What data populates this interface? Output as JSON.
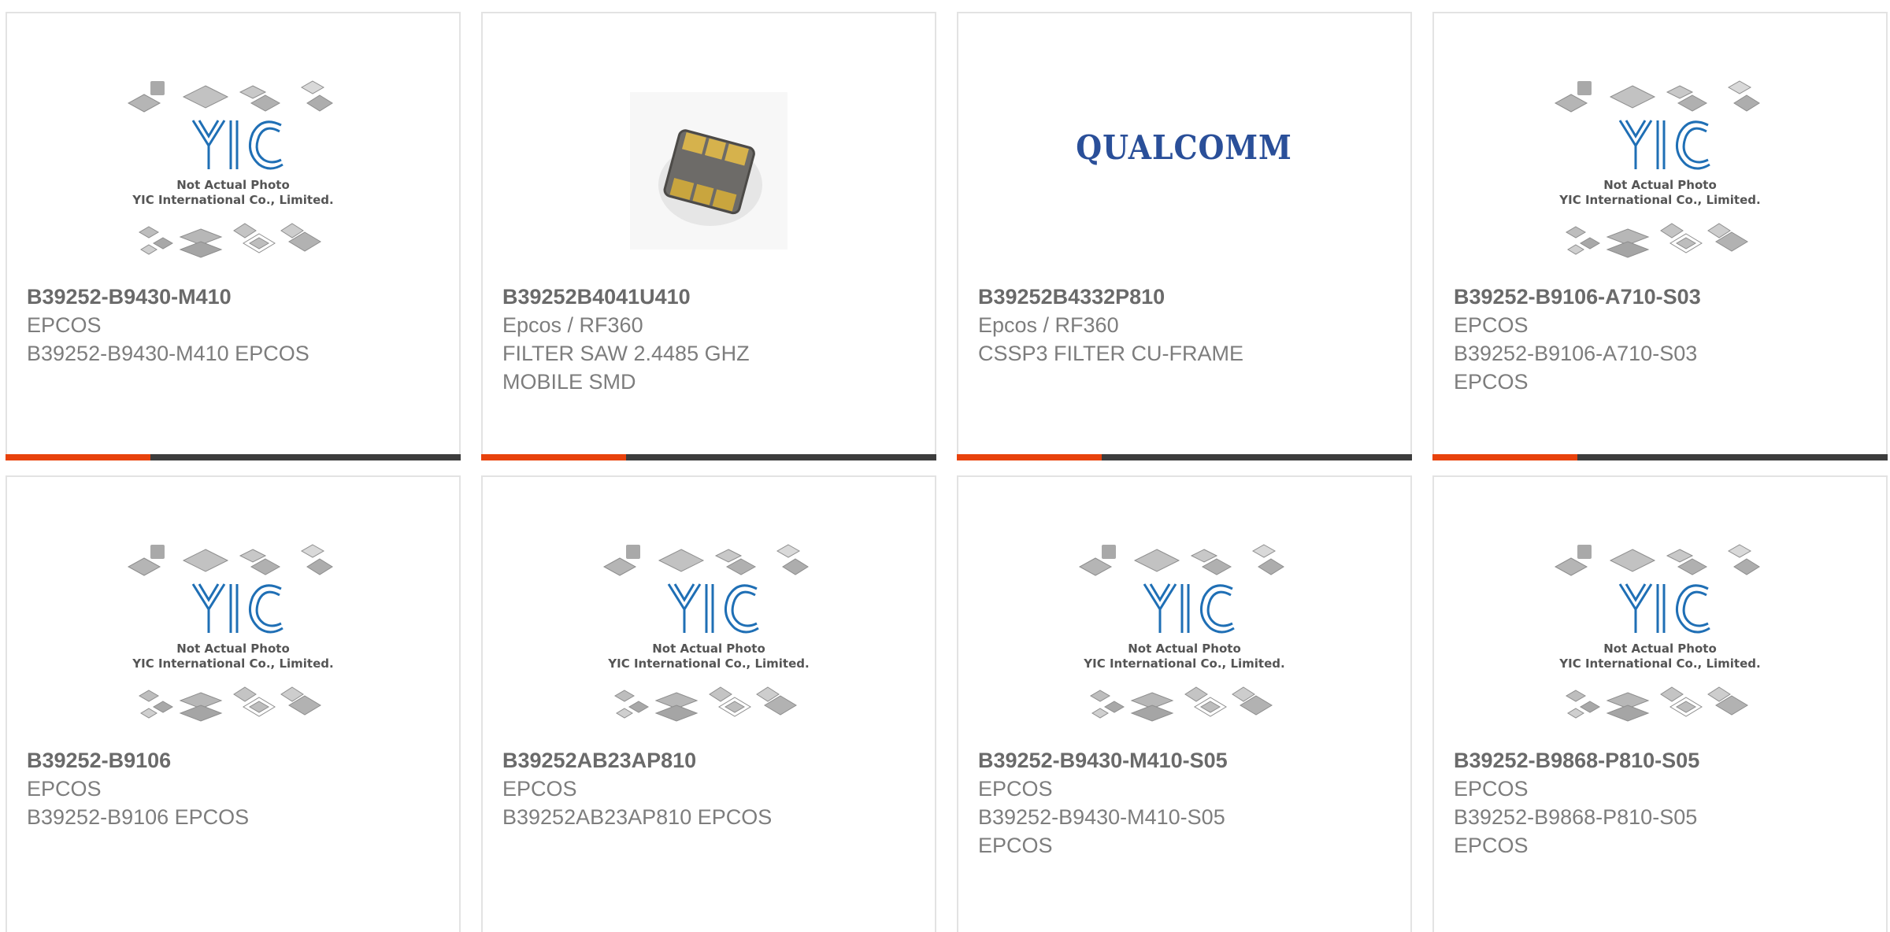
{
  "placeholder_image": {
    "line1": "Not Actual Photo",
    "line2": "YIC International Co., Limited.",
    "logo": "YIC"
  },
  "colors": {
    "accent": "#e8420c",
    "bar": "#3d3d3d",
    "yic_blue": "#1f6fb5",
    "qualcomm_blue": "#2a4f99"
  },
  "products": [
    {
      "part": "B39252-B9430-M410",
      "manufacturer": "EPCOS",
      "desc1": "B39252-B9430-M410 EPCOS",
      "desc2": "",
      "image": "yic-placeholder"
    },
    {
      "part": "B39252B4041U410",
      "manufacturer": "Epcos / RF360",
      "desc1": "FILTER SAW 2.4485 GHZ",
      "desc2": "MOBILE SMD",
      "image": "smd-chip"
    },
    {
      "part": "B39252B4332P810",
      "manufacturer": "Epcos / RF360",
      "desc1": "CSSP3 FILTER CU-FRAME",
      "desc2": "",
      "image": "qualcomm-logo",
      "logo_text": "QUALCOMM"
    },
    {
      "part": "B39252-B9106-A710-S03",
      "manufacturer": "EPCOS",
      "desc1": "B39252-B9106-A710-S03",
      "desc2": "EPCOS",
      "image": "yic-placeholder"
    },
    {
      "part": "B39252-B9106",
      "manufacturer": "EPCOS",
      "desc1": "B39252-B9106 EPCOS",
      "desc2": "",
      "image": "yic-placeholder"
    },
    {
      "part": "B39252AB23AP810",
      "manufacturer": "EPCOS",
      "desc1": "B39252AB23AP810 EPCOS",
      "desc2": "",
      "image": "yic-placeholder"
    },
    {
      "part": "B39252-B9430-M410-S05",
      "manufacturer": "EPCOS",
      "desc1": "B39252-B9430-M410-S05",
      "desc2": "EPCOS",
      "image": "yic-placeholder"
    },
    {
      "part": "B39252-B9868-P810-S05",
      "manufacturer": "EPCOS",
      "desc1": "B39252-B9868-P810-S05",
      "desc2": "EPCOS",
      "image": "yic-placeholder"
    }
  ]
}
